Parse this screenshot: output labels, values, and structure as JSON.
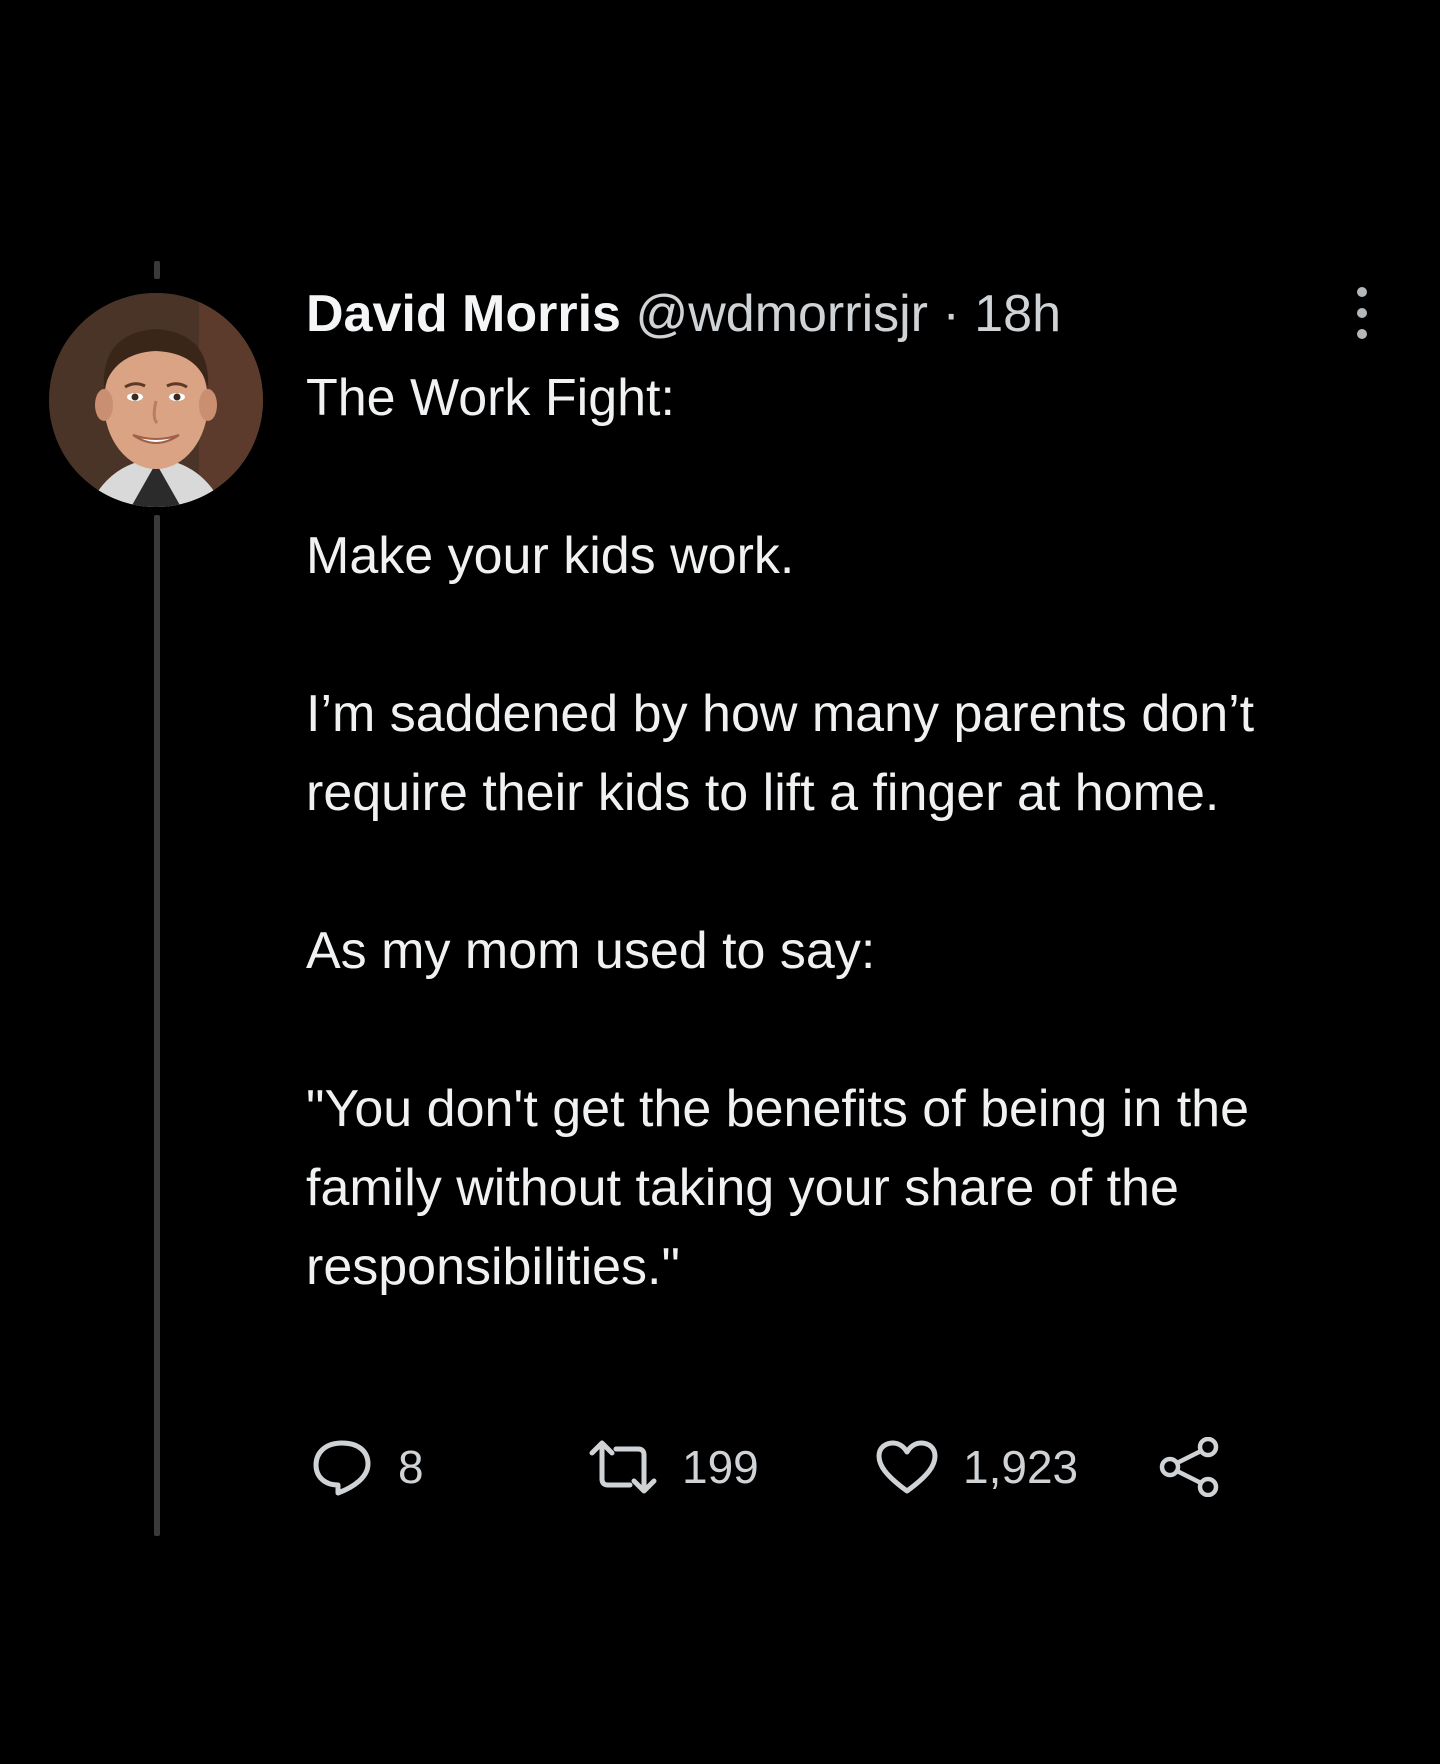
{
  "tweet": {
    "author_name": "David Morris",
    "author_handle": "@wdmorrisjr",
    "separator": "·",
    "timestamp": "18h",
    "body": {
      "line1": "The Work Fight:",
      "line2": "Make your kids work.",
      "line3": "I’m saddened by how many parents don’t require their kids to lift a finger at home.",
      "line4": "As my mom used to say:",
      "line5": "\"You don't get the benefits of being in the family without taking your share of the responsibilities.\""
    },
    "actions": {
      "replies": "8",
      "retweets": "199",
      "likes": "1,923"
    }
  },
  "colors": {
    "background": "#000000",
    "text": "#e7e9ea",
    "muted": "#d0d3d6",
    "thread_line": "#3a3a3a"
  },
  "icons": [
    "more-icon",
    "reply-icon",
    "retweet-icon",
    "like-icon",
    "share-icon"
  ]
}
